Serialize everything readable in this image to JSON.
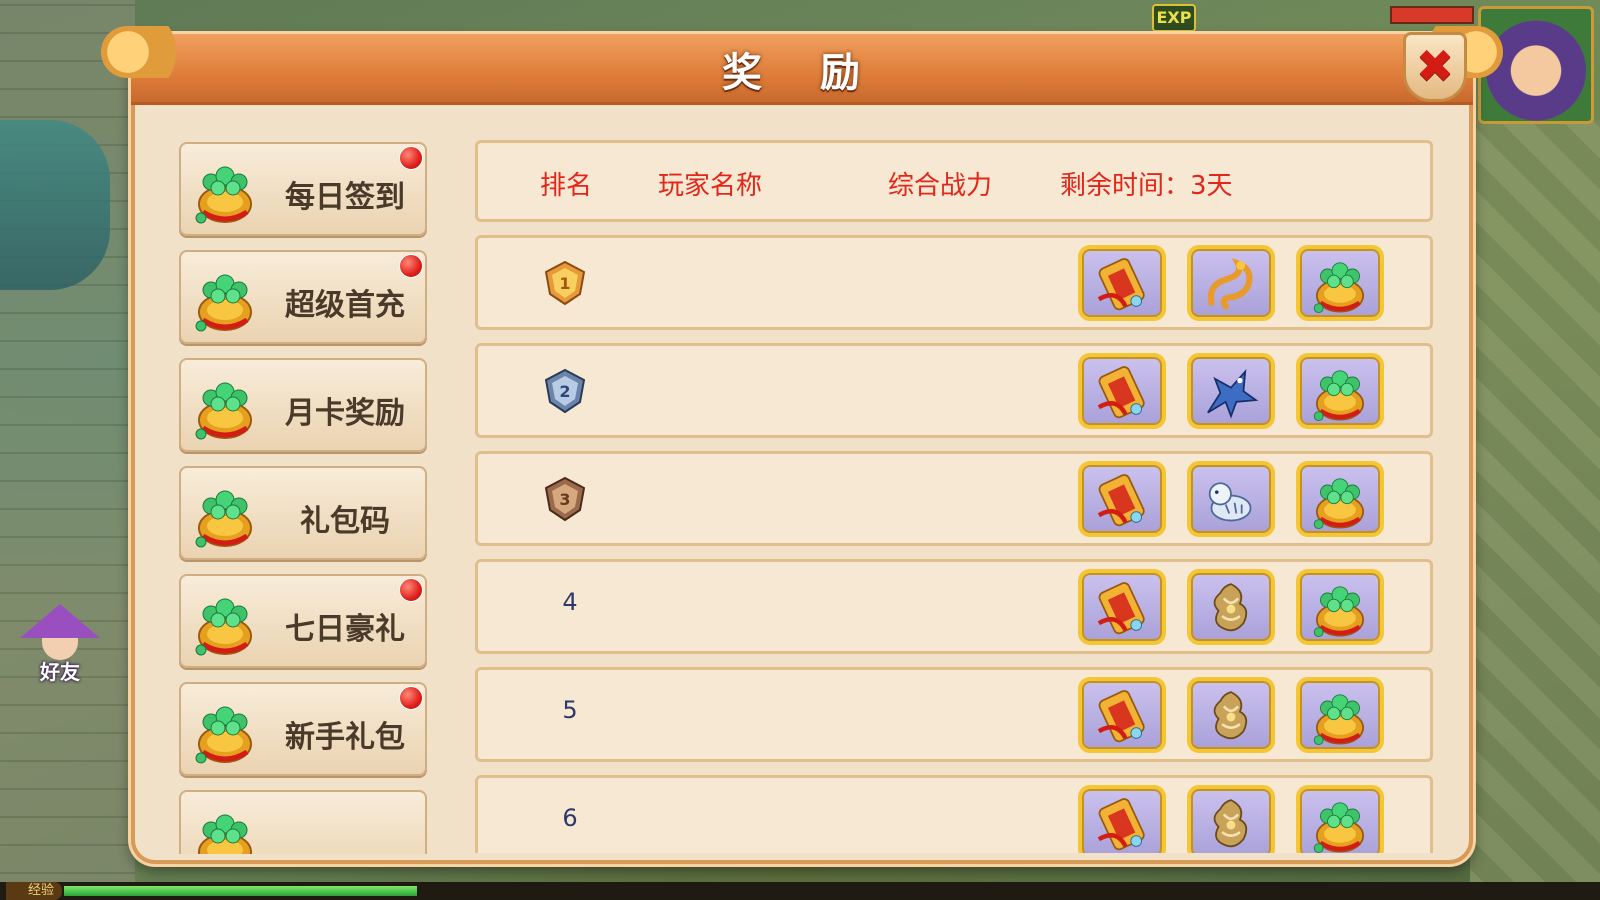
{
  "hud": {
    "exp_badge": "EXP",
    "friend_label": "好友",
    "exp_bar_label": "经验",
    "exp_progress": 0.23
  },
  "panel": {
    "title": "奖 励",
    "close_icon": "close-icon"
  },
  "sidebar": {
    "items": [
      {
        "label": "每日签到",
        "badge": true,
        "icon": "money-bag-icon"
      },
      {
        "label": "超级首充",
        "badge": true,
        "icon": "money-bag-icon"
      },
      {
        "label": "月卡奖励",
        "badge": false,
        "icon": "money-bag-icon"
      },
      {
        "label": "礼包码",
        "badge": false,
        "icon": "money-bag-icon"
      },
      {
        "label": "七日豪礼",
        "badge": true,
        "icon": "money-bag-icon"
      },
      {
        "label": "新手礼包",
        "badge": true,
        "icon": "money-bag-icon"
      },
      {
        "label": "",
        "badge": false,
        "icon": "money-bag-icon"
      }
    ]
  },
  "table": {
    "headers": {
      "rank": "排名",
      "player": "玩家名称",
      "power": "综合战力",
      "time": "剩余时间：3天"
    },
    "rows": [
      {
        "rank": "1",
        "medal": "gold-medal-icon",
        "rewards": [
          "scroll-icon",
          "golden-dragon-icon",
          "money-bag-icon"
        ]
      },
      {
        "rank": "2",
        "medal": "silver-medal-icon",
        "rewards": [
          "scroll-icon",
          "blue-dragon-icon",
          "money-bag-icon"
        ]
      },
      {
        "rank": "3",
        "medal": "bronze-medal-icon",
        "rewards": [
          "scroll-icon",
          "white-tiger-icon",
          "money-bag-icon"
        ]
      },
      {
        "rank": "4",
        "medal": "",
        "rewards": [
          "scroll-icon",
          "golden-beast-icon",
          "money-bag-icon"
        ]
      },
      {
        "rank": "5",
        "medal": "",
        "rewards": [
          "scroll-icon",
          "golden-beast-icon",
          "money-bag-icon"
        ]
      },
      {
        "rank": "6",
        "medal": "",
        "rewards": [
          "scroll-icon",
          "golden-beast-icon",
          "money-bag-icon"
        ]
      }
    ]
  },
  "colors": {
    "header_text": "#e3261a",
    "title_bar": "#df7d3a",
    "panel_bg": "#f1e1c9",
    "reward_border": "#f5c634"
  }
}
